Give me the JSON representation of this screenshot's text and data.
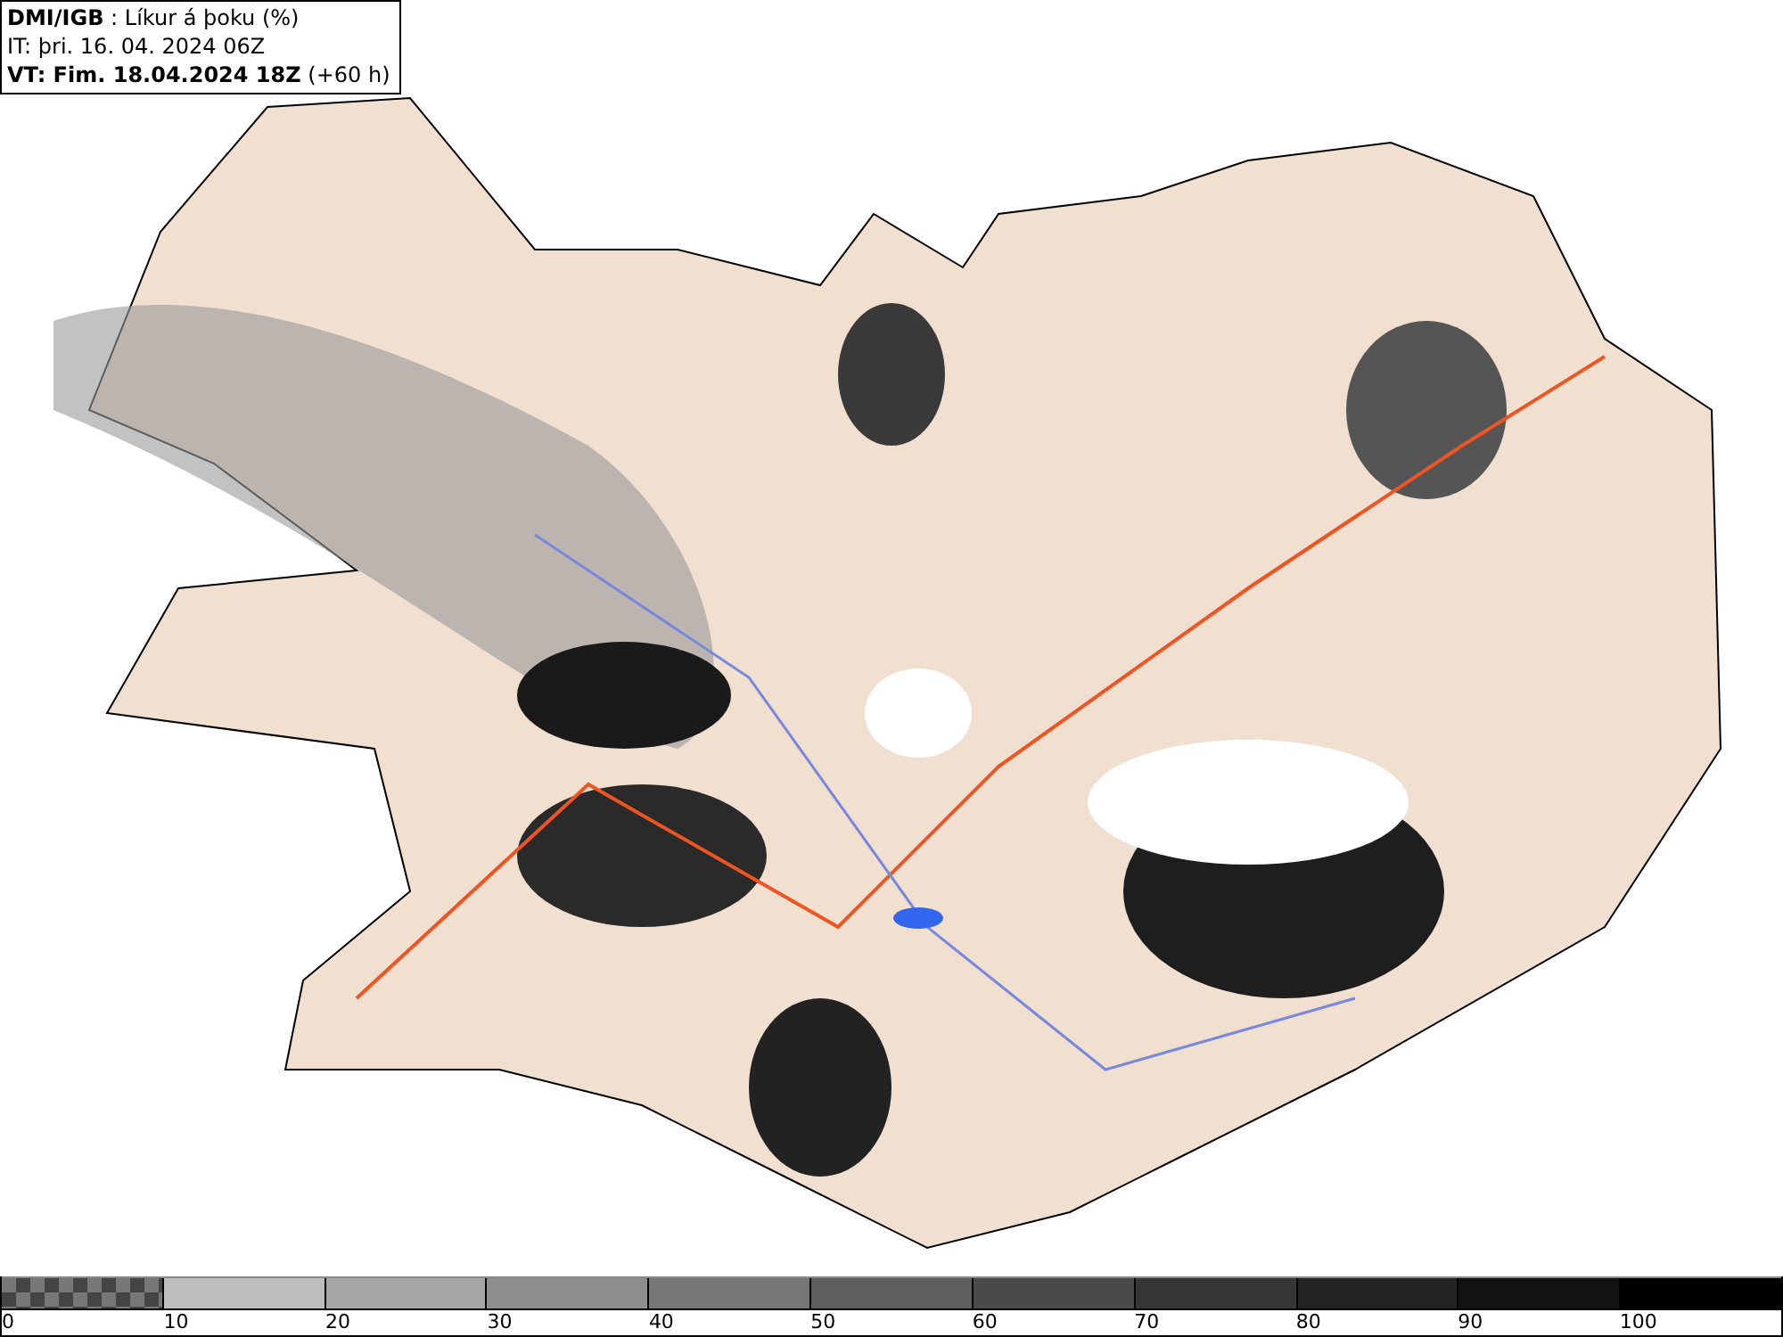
{
  "header": {
    "lines": [
      "**DMI/IGB** : Líkur á þoku (%)",
      "IT: þri. 16. 04. 2024 06Z",
      "**VT: Fim. 18.04.2024 18Z** (+60 h)"
    ]
  },
  "legend": [
    {
      "kind": "checkered",
      "label": "0"
    },
    {
      "kind": "solid",
      "color": "#bdbdbd",
      "label": "10"
    },
    {
      "kind": "solid",
      "color": "#a6a6a6",
      "label": "20"
    },
    {
      "kind": "solid",
      "color": "#8e8e8e",
      "label": "30"
    },
    {
      "kind": "solid",
      "color": "#767676",
      "label": "40"
    },
    {
      "kind": "solid",
      "color": "#5e5e5e",
      "label": "50"
    },
    {
      "kind": "solid",
      "color": "#4a4a4a",
      "label": "60"
    },
    {
      "kind": "solid",
      "color": "#363636",
      "label": "70"
    },
    {
      "kind": "solid",
      "color": "#232323",
      "label": "80"
    },
    {
      "kind": "solid",
      "color": "#121212",
      "label": "90"
    },
    {
      "kind": "solid",
      "color": "#000000",
      "label": "100"
    }
  ]
}
